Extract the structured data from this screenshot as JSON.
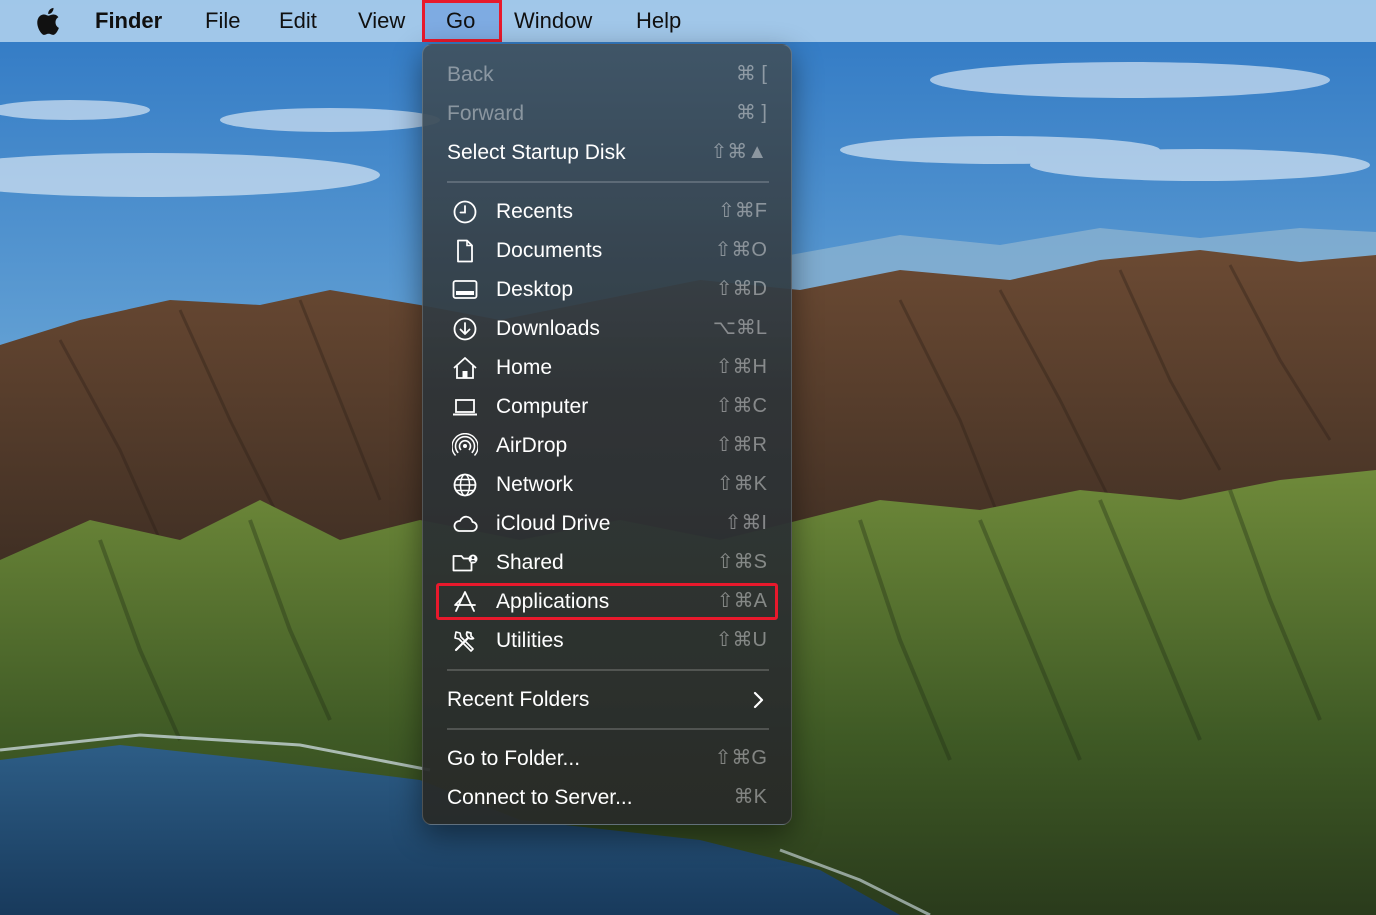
{
  "menubar": {
    "apple_icon": "apple-logo-icon",
    "app_name": "Finder",
    "items": [
      "File",
      "Edit",
      "View",
      "Go",
      "Window",
      "Help"
    ],
    "active_item": "Go"
  },
  "go_menu": {
    "nav": [
      {
        "label": "Back",
        "shortcut": "⌘ [",
        "enabled": false
      },
      {
        "label": "Forward",
        "shortcut": "⌘ ]",
        "enabled": false
      },
      {
        "label": "Select Startup Disk",
        "shortcut": "⇧⌘▲",
        "enabled": true
      }
    ],
    "places": [
      {
        "label": "Recents",
        "shortcut": "⇧⌘F",
        "icon": "clock-icon"
      },
      {
        "label": "Documents",
        "shortcut": "⇧⌘O",
        "icon": "document-icon"
      },
      {
        "label": "Desktop",
        "shortcut": "⇧⌘D",
        "icon": "desktop-icon"
      },
      {
        "label": "Downloads",
        "shortcut": "⌥⌘L",
        "icon": "download-icon"
      },
      {
        "label": "Home",
        "shortcut": "⇧⌘H",
        "icon": "home-icon"
      },
      {
        "label": "Computer",
        "shortcut": "⇧⌘C",
        "icon": "laptop-icon"
      },
      {
        "label": "AirDrop",
        "shortcut": "⇧⌘R",
        "icon": "airdrop-icon"
      },
      {
        "label": "Network",
        "shortcut": "⇧⌘K",
        "icon": "globe-icon"
      },
      {
        "label": "iCloud Drive",
        "shortcut": "⇧⌘I",
        "icon": "cloud-icon"
      },
      {
        "label": "Shared",
        "shortcut": "⇧⌘S",
        "icon": "shared-folder-icon"
      },
      {
        "label": "Applications",
        "shortcut": "⇧⌘A",
        "icon": "applications-icon",
        "highlighted": true
      },
      {
        "label": "Utilities",
        "shortcut": "⇧⌘U",
        "icon": "utilities-icon"
      }
    ],
    "recent_folders": {
      "label": "Recent Folders",
      "icon": "chevron-right-icon"
    },
    "go_to": [
      {
        "label": "Go to Folder...",
        "shortcut": "⇧⌘G"
      },
      {
        "label": "Connect to Server...",
        "shortcut": "⌘K"
      }
    ]
  },
  "colors": {
    "highlight_border": "#e8192c",
    "menu_text": "#ffffff",
    "menubar_bg": "#b0d2ee"
  }
}
